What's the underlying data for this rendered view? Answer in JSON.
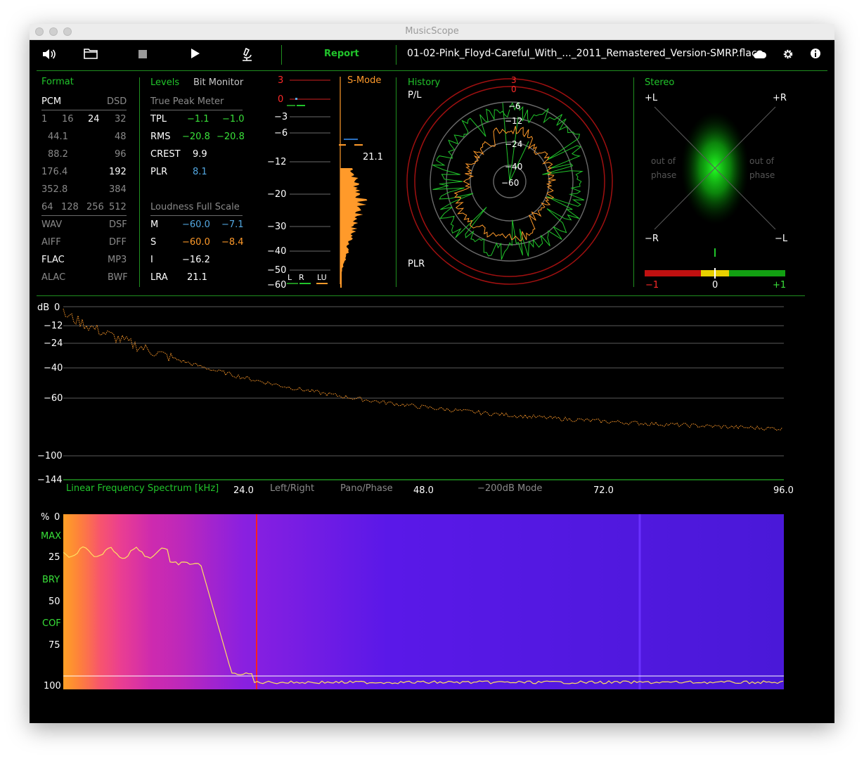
{
  "window": {
    "title": "MusicScope"
  },
  "toolbar": {
    "report_label": "Report",
    "filename": "01-02-Pink_Floyd-Careful_With_..._2011_Remastered_Version-SMRP.flac",
    "icons": [
      "speaker-icon",
      "folder-icon",
      "stop-icon",
      "play-icon",
      "microscope-icon",
      "cloud-icon",
      "gear-icon",
      "info-icon"
    ]
  },
  "format": {
    "title": "Format",
    "pcm": "PCM",
    "dsd": "DSD",
    "bits": [
      "1",
      "16",
      "24",
      "32"
    ],
    "rates": [
      [
        "44.1",
        "48"
      ],
      [
        "88.2",
        "96"
      ],
      [
        "176.4",
        "192"
      ],
      [
        "352.8",
        "384"
      ]
    ],
    "dsd_rates": [
      "64",
      "128",
      "256",
      "512"
    ],
    "containers": [
      [
        "WAV",
        "DSF"
      ],
      [
        "AIFF",
        "DFF"
      ],
      [
        "FLAC",
        "MP3"
      ],
      [
        "ALAC",
        "BWF"
      ]
    ]
  },
  "levels": {
    "tab_levels": "Levels",
    "tab_bit": "Bit Monitor",
    "tpm_title": "True Peak Meter",
    "rows": [
      {
        "label": "TPL",
        "l": "−1.1",
        "r": "−1.0"
      },
      {
        "label": "RMS",
        "l": "−20.8",
        "r": "−20.8"
      },
      {
        "label": "CREST",
        "l": "9.9",
        "r": ""
      },
      {
        "label": "PLR",
        "l": "8.1",
        "r": ""
      }
    ],
    "lfs_title": "Loudness Full Scale",
    "loud_rows": [
      {
        "label": "M",
        "a": "−60.0",
        "b": "−7.1"
      },
      {
        "label": "S",
        "a": "−60.0",
        "b": "−8.4"
      },
      {
        "label": "I",
        "a": "−16.2",
        "b": ""
      },
      {
        "label": "LRA",
        "a": "21.1",
        "b": ""
      }
    ]
  },
  "meter": {
    "mode": "S-Mode",
    "scale": [
      "3",
      "0",
      "−3",
      "−6",
      "−12",
      "−20",
      "−30",
      "−40",
      "−50",
      "−60"
    ],
    "lra_value": "21.1",
    "channels": [
      "L",
      "R",
      "LU"
    ]
  },
  "history": {
    "title": "History",
    "top_left": "P/L",
    "bottom_left": "PLR",
    "rings": [
      "3",
      "0",
      "−6",
      "−12",
      "−24",
      "−40",
      "−60"
    ]
  },
  "stereo": {
    "title": "Stereo",
    "plus_l": "+L",
    "plus_r": "+R",
    "minus_r": "−R",
    "minus_l": "−L",
    "out_of": "out of",
    "phase": "phase",
    "corr_left": "−1",
    "corr_mid": "0",
    "corr_right": "+1"
  },
  "spectrum": {
    "db_label": "dB",
    "y_labels": [
      "0",
      "−12",
      "−24",
      "−40",
      "−60",
      "−100",
      "−144"
    ],
    "title": "Linear Frequency Spectrum [kHz]",
    "x_labels": [
      "24.0",
      "48.0",
      "72.0",
      "96.0"
    ],
    "options": [
      "Left/Right",
      "Pano/Phase",
      "−200dB Mode"
    ]
  },
  "spectrogram": {
    "labels": [
      "%",
      "0",
      "MAX",
      "25",
      "BRY",
      "50",
      "COF",
      "75",
      "100"
    ]
  },
  "colors": {
    "green": "#21c52b",
    "orange": "#ff9a2a",
    "red": "#ff2a2a",
    "blue": "#53a8e2",
    "bg": "#000000"
  }
}
